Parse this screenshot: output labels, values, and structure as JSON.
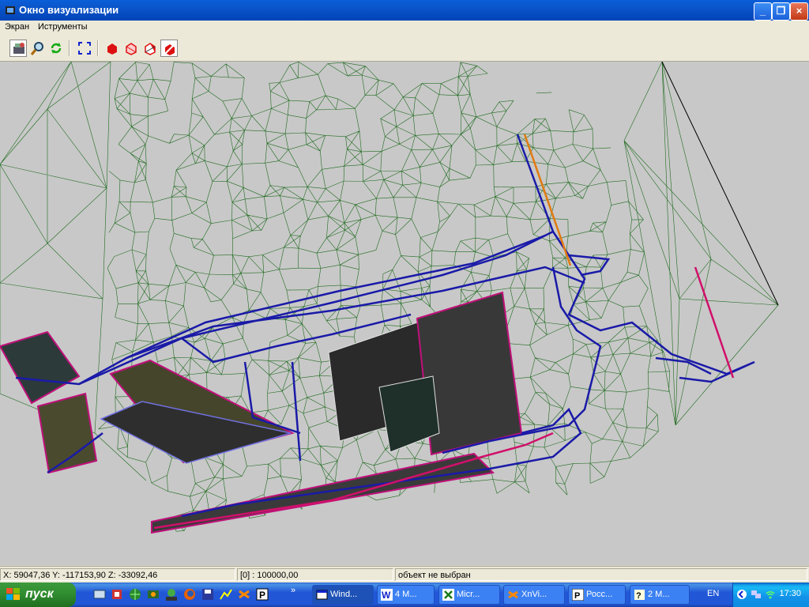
{
  "window": {
    "title": "Окно визуализации"
  },
  "menu": {
    "items": [
      "Экран",
      "Иструменты"
    ]
  },
  "toolbar": {
    "buttons": [
      "open-model",
      "zoom",
      "refresh",
      "fit-view",
      "solid-shading",
      "wire-shading",
      "hidden-lines",
      "cut-view"
    ]
  },
  "status": {
    "coords": "X: 59047,36   Y: -117153,90   Z: -33092,46",
    "scale": "[0] : 100000,00",
    "selection": "объект не выбран"
  },
  "taskbar": {
    "start_label": "пуск",
    "chevron": "»",
    "tasks": [
      "Wind...",
      "4 M...",
      "Micr...",
      "XnVi...",
      "Росс...",
      "2 M..."
    ],
    "language": "EN",
    "clock": "17:30"
  },
  "colors": {
    "mesh": "#1f6b1f",
    "pipes": "#1a1aa8",
    "highlight": "#d0106a",
    "orange_line": "#e07a10",
    "viewport_bg": "#c8c8c8"
  }
}
